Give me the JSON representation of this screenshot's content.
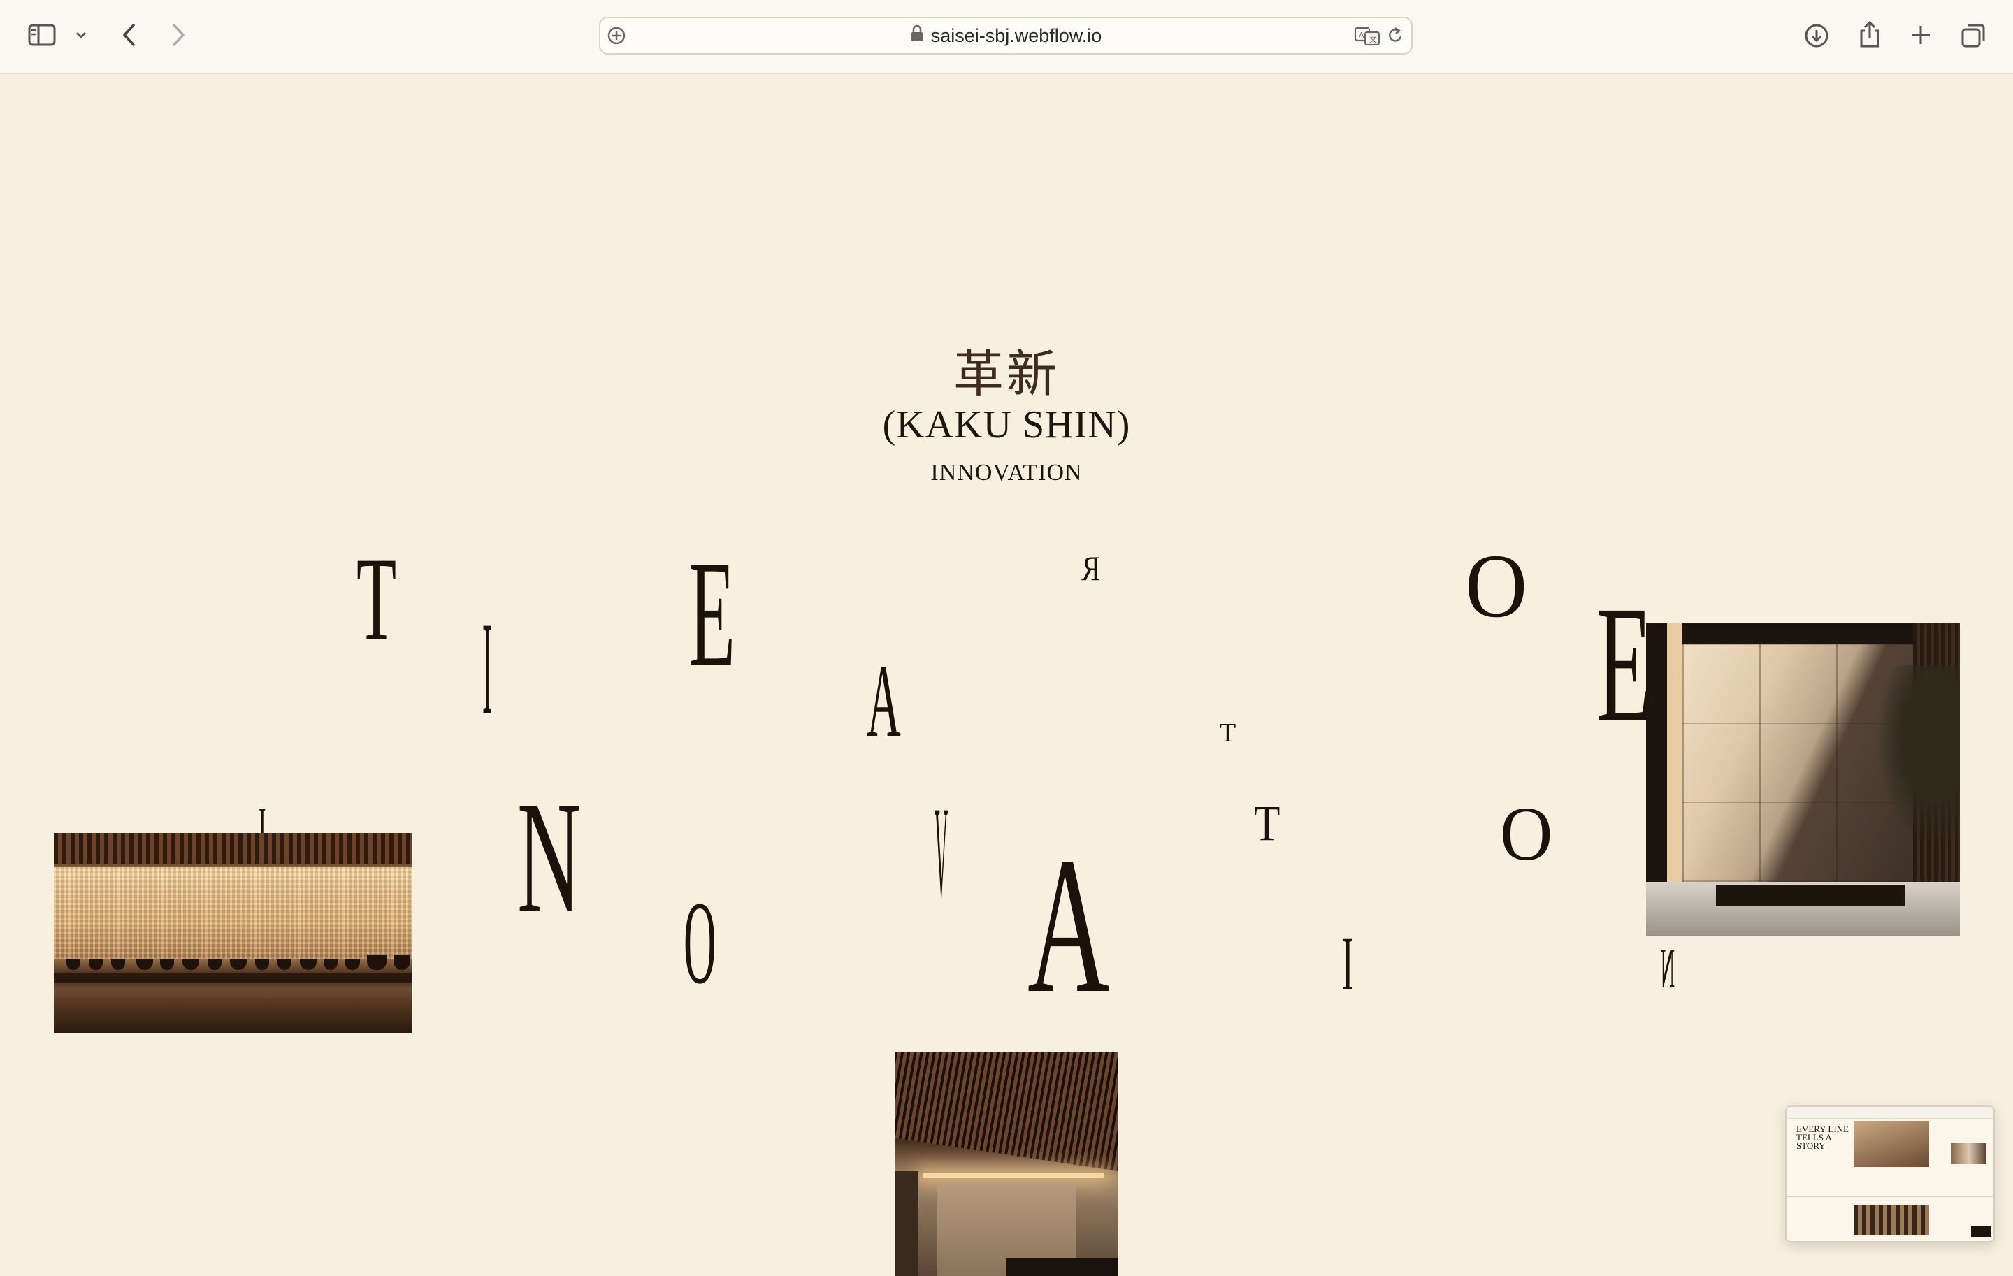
{
  "browser": {
    "url": "saisei-sbj.webflow.io",
    "icons": [
      "sidebar-icon",
      "chevron-down-icon",
      "back-icon",
      "forward-icon",
      "site-settings-icon",
      "lock-icon",
      "translate-icon",
      "reload-icon",
      "download-icon",
      "share-icon",
      "new-tab-icon",
      "tab-overview-icon"
    ]
  },
  "hero": {
    "kanji": "革新",
    "reading": "(KAKU SHIN)",
    "translation": "INNOVATION"
  },
  "scattered_letters": {
    "l1": "T",
    "l2": "I",
    "l3": "E",
    "l4": "A",
    "l5": "R",
    "l6": "T",
    "l7": "O",
    "l8": "E",
    "l9": "I",
    "l10": "N",
    "l11": "O",
    "l12": "V",
    "l13": "A",
    "l14": "T",
    "l15": "O",
    "l16": "I",
    "l17": "N"
  },
  "thumbnail": {
    "title": "EVERY LINE TELLS A STORY"
  }
}
